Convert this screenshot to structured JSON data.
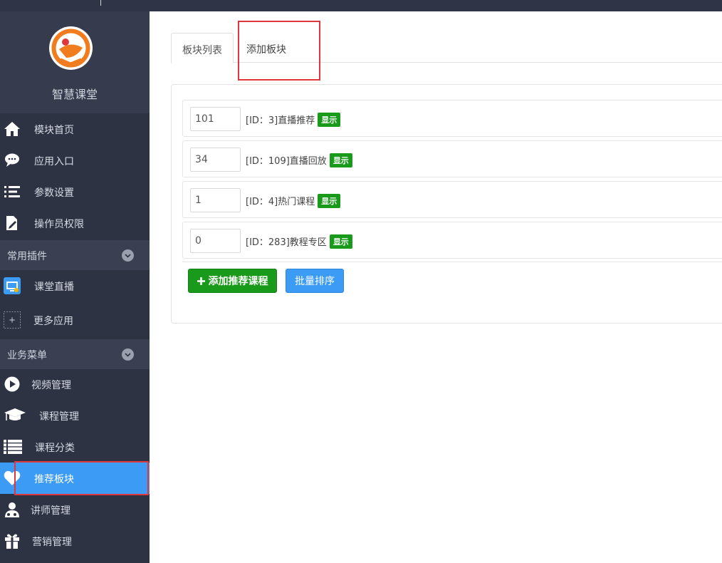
{
  "brand": {
    "name": "智慧课堂"
  },
  "sidebar": {
    "top_items": [
      {
        "label": "模块首页",
        "icon": "home-icon"
      },
      {
        "label": "应用入口",
        "icon": "chat-icon"
      },
      {
        "label": "参数设置",
        "icon": "settings-list-icon"
      },
      {
        "label": "操作员权限",
        "icon": "edit-doc-icon"
      }
    ],
    "plugins_section": {
      "label": "常用插件"
    },
    "plugins": [
      {
        "label": "课堂直播",
        "icon": "live-icon"
      },
      {
        "label": "更多应用",
        "icon": "plus-box-icon"
      }
    ],
    "business_section": {
      "label": "业务菜单"
    },
    "business": [
      {
        "label": "视频管理",
        "icon": "play-icon"
      },
      {
        "label": "课程管理",
        "icon": "mortarboard-icon"
      },
      {
        "label": "课程分类",
        "icon": "list-icon"
      },
      {
        "label": "推荐板块",
        "icon": "heart-icon"
      },
      {
        "label": "讲师管理",
        "icon": "teacher-icon"
      },
      {
        "label": "营销管理",
        "icon": "gift-icon"
      }
    ]
  },
  "tabs": [
    {
      "label": "板块列表"
    },
    {
      "label": "添加板块"
    }
  ],
  "blocks": [
    {
      "order": "101",
      "info": "[ID：3]直播推荐",
      "status": "显示"
    },
    {
      "order": "34",
      "info": "[ID：109]直播回放",
      "status": "显示"
    },
    {
      "order": "1",
      "info": "[ID：4]热门课程",
      "status": "显示"
    },
    {
      "order": "0",
      "info": "[ID：283]教程专区",
      "status": "显示"
    }
  ],
  "actions": {
    "add_label": "添加推荐课程",
    "sort_label": "批量排序"
  },
  "colors": {
    "sidebar_bg": "#2e3344",
    "active_bg": "#3c9cf5",
    "success": "#1a9a1a",
    "highlight": "#e0363d"
  }
}
